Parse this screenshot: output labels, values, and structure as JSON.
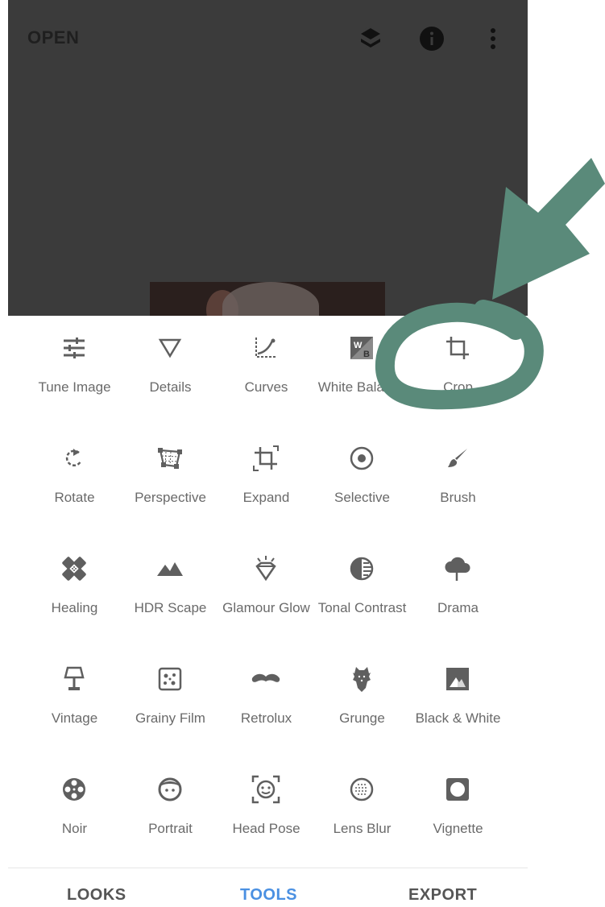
{
  "header": {
    "open_label": "OPEN",
    "icons": [
      "layers-undo-icon",
      "info-icon",
      "more-vert-icon"
    ]
  },
  "tools": [
    {
      "label": "Tune Image",
      "icon": "tune-sliders-icon"
    },
    {
      "label": "Details",
      "icon": "details-triangle-icon"
    },
    {
      "label": "Curves",
      "icon": "curves-icon"
    },
    {
      "label": "White Balance",
      "icon": "white-balance-icon"
    },
    {
      "label": "Crop",
      "icon": "crop-icon"
    },
    {
      "label": "Rotate",
      "icon": "rotate-icon"
    },
    {
      "label": "Perspective",
      "icon": "perspective-icon"
    },
    {
      "label": "Expand",
      "icon": "expand-icon"
    },
    {
      "label": "Selective",
      "icon": "selective-icon"
    },
    {
      "label": "Brush",
      "icon": "brush-icon"
    },
    {
      "label": "Healing",
      "icon": "healing-bandage-icon"
    },
    {
      "label": "HDR Scape",
      "icon": "mountains-icon"
    },
    {
      "label": "Glamour Glow",
      "icon": "diamond-glow-icon"
    },
    {
      "label": "Tonal Contrast",
      "icon": "tonal-contrast-icon"
    },
    {
      "label": "Drama",
      "icon": "storm-cloud-icon"
    },
    {
      "label": "Vintage",
      "icon": "lamp-icon"
    },
    {
      "label": "Grainy Film",
      "icon": "grain-dice-icon"
    },
    {
      "label": "Retrolux",
      "icon": "mustache-icon"
    },
    {
      "label": "Grunge",
      "icon": "grunge-guitar-icon"
    },
    {
      "label": "Black & White",
      "icon": "black-white-icon"
    },
    {
      "label": "Noir",
      "icon": "film-reel-icon"
    },
    {
      "label": "Portrait",
      "icon": "face-icon"
    },
    {
      "label": "Head Pose",
      "icon": "face-focus-icon"
    },
    {
      "label": "Lens Blur",
      "icon": "lens-blur-icon"
    },
    {
      "label": "Vignette",
      "icon": "vignette-icon"
    }
  ],
  "bottom_nav": {
    "looks": "LOOKS",
    "tools": "TOOLS",
    "export": "EXPORT",
    "active": "TOOLS"
  },
  "colors": {
    "photo_bg": "#3b3b3b",
    "icon_gray": "#5f5f5f",
    "label_gray": "#6a6a6a",
    "active_tab": "#4a90e2",
    "inactive_tab": "#555555",
    "annotation": "#5a8a7a"
  }
}
